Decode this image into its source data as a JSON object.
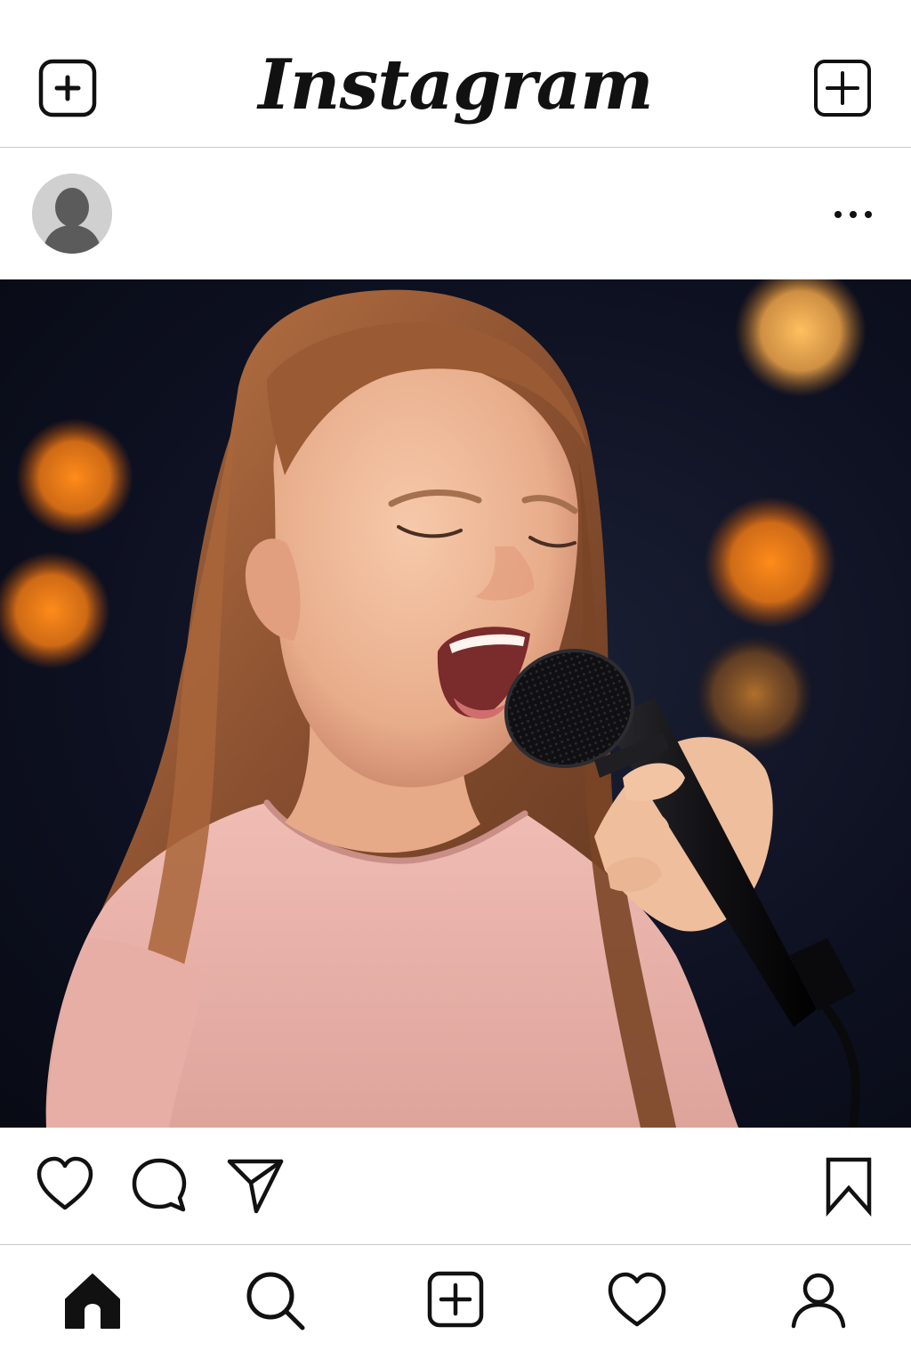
{
  "header": {
    "brand": "Instagram",
    "left_icon": "add-post-icon",
    "right_icon": "add-icon"
  },
  "post": {
    "avatar_icon": "default-avatar-icon",
    "more_icon": "more-options-icon",
    "image_description_icon": "photo",
    "actions": {
      "like_icon": "heart-icon",
      "comment_icon": "comment-icon",
      "share_icon": "send-icon",
      "save_icon": "bookmark-icon"
    }
  },
  "bottom_nav": {
    "items": [
      "home-icon",
      "search-icon",
      "add-icon",
      "heart-icon",
      "profile-icon"
    ],
    "active": "home-icon"
  },
  "colors": {
    "icon": "#111111",
    "divider": "#c9c9c9",
    "photo_background": "#0d1020",
    "bokeh_light": "#f28a22",
    "shirt": "#e9b3ad",
    "hair": "#8a5030"
  }
}
